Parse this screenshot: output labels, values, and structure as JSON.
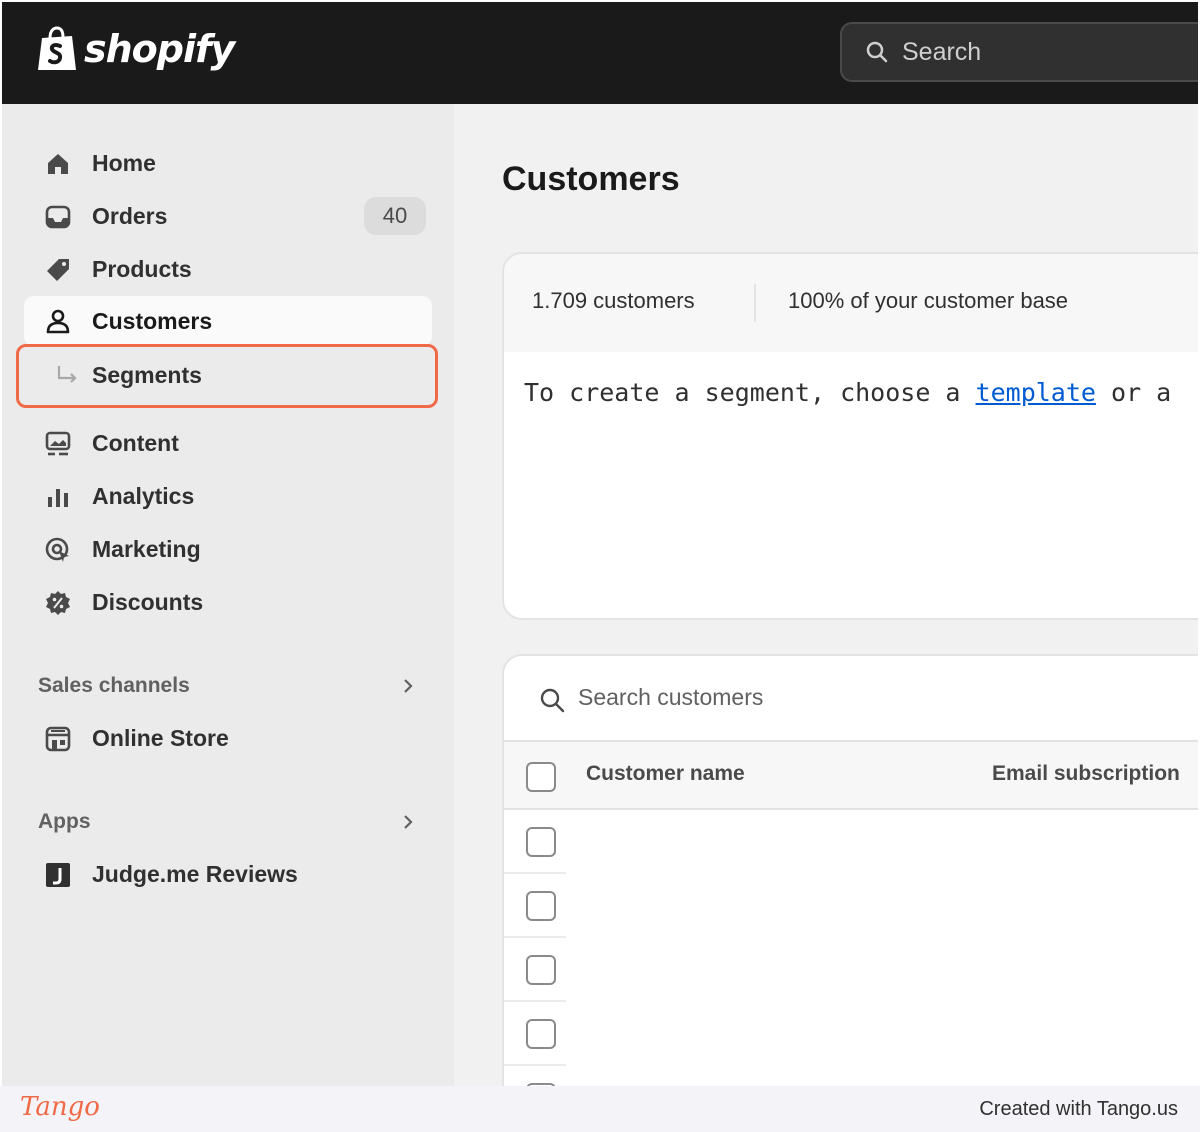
{
  "topbar": {
    "logo_text": "shopify",
    "search_placeholder": "Search"
  },
  "sidebar": {
    "items": [
      {
        "label": "Home",
        "icon": "home-icon"
      },
      {
        "label": "Orders",
        "icon": "inbox-icon",
        "badge": "40"
      },
      {
        "label": "Products",
        "icon": "tag-icon"
      },
      {
        "label": "Customers",
        "icon": "person-icon",
        "active": true
      },
      {
        "label": "Segments",
        "icon": "arrow-return-icon",
        "highlighted": true
      },
      {
        "label": "Content",
        "icon": "image-icon"
      },
      {
        "label": "Analytics",
        "icon": "bar-chart-icon"
      },
      {
        "label": "Marketing",
        "icon": "target-icon"
      },
      {
        "label": "Discounts",
        "icon": "discount-icon"
      }
    ],
    "sales_channels": {
      "heading": "Sales channels",
      "items": [
        {
          "label": "Online Store",
          "icon": "store-icon"
        }
      ]
    },
    "apps": {
      "heading": "Apps",
      "items": [
        {
          "label": "Judge.me Reviews",
          "icon": "judgeme-icon"
        }
      ]
    }
  },
  "main": {
    "title": "Customers",
    "stats": {
      "count": "1.709 customers",
      "percentage": "100% of your customer base"
    },
    "editor": {
      "text_before": "To create a segment, choose a ",
      "link": "template",
      "text_after": " or a"
    },
    "table": {
      "search_placeholder": "Search customers",
      "columns": [
        "Customer name",
        "Email subscription"
      ]
    }
  },
  "footer": {
    "brand": "Tango",
    "created": "Created with Tango.us"
  },
  "colors": {
    "topbar": "#1a1a1a",
    "highlight": "#f06a48",
    "link": "#005bd3"
  }
}
